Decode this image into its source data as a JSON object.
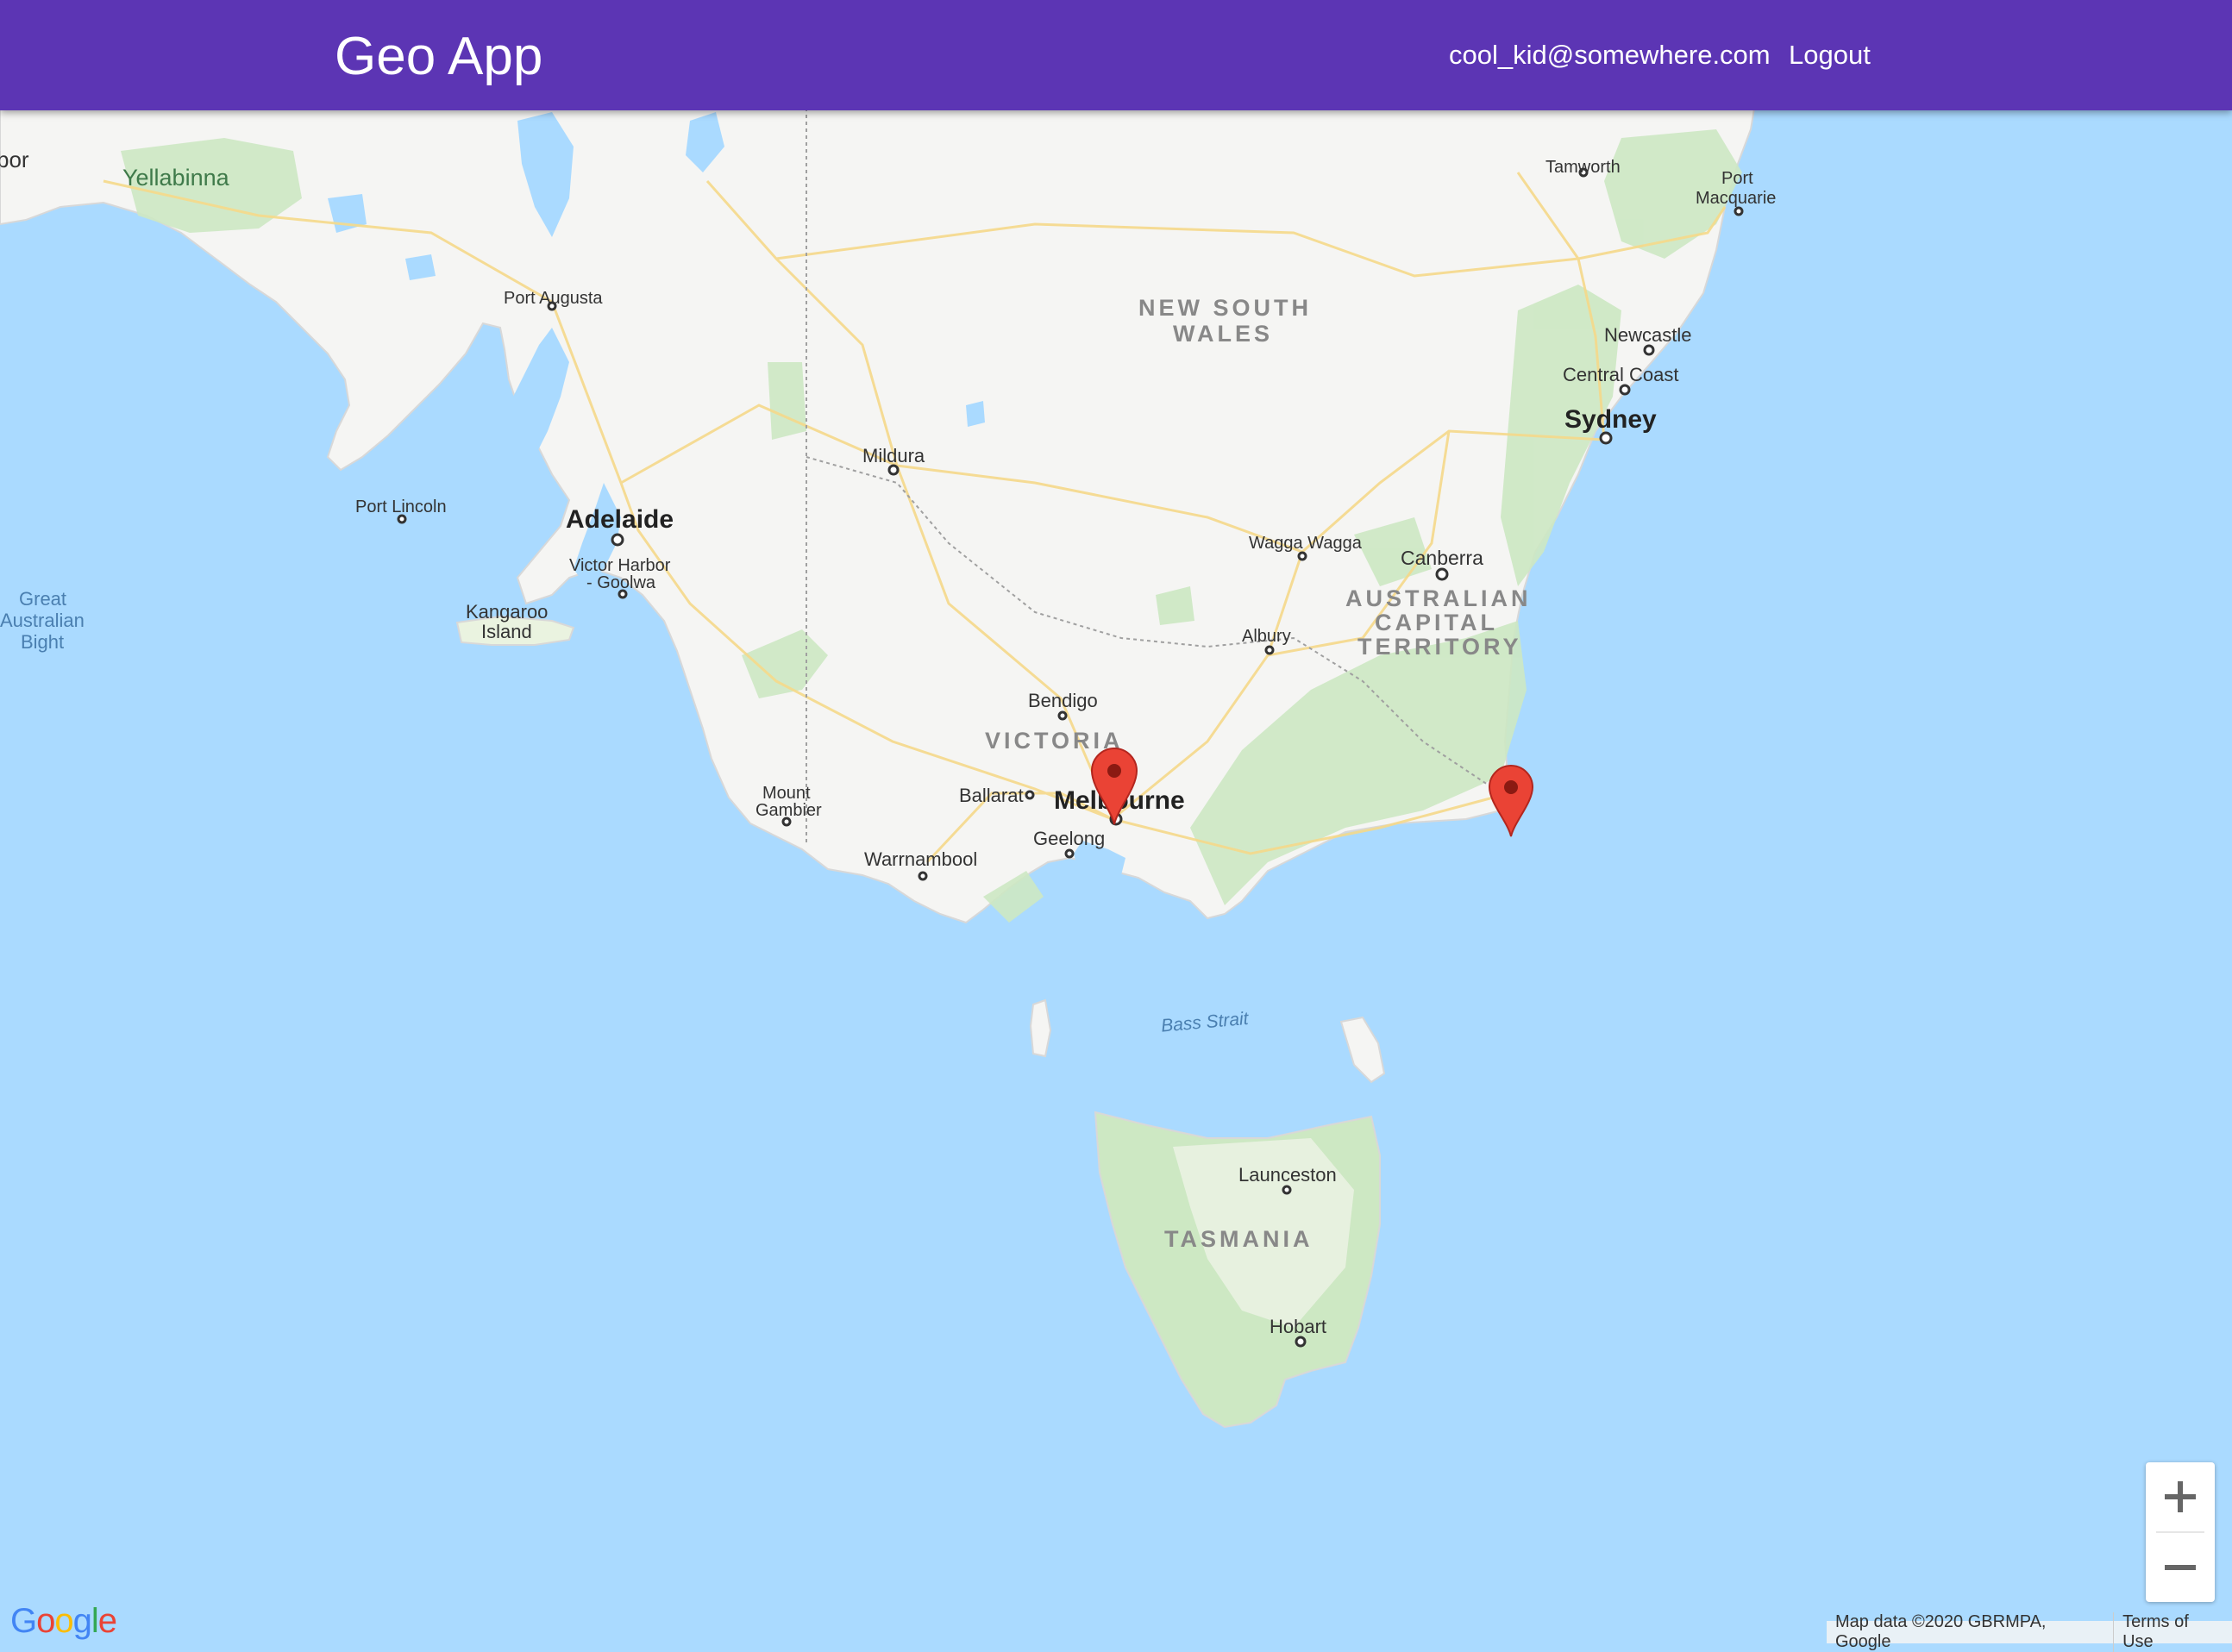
{
  "header": {
    "title": "Geo App",
    "user_email": "cool_kid@somewhere.com",
    "logout_label": "Logout"
  },
  "map": {
    "places": {
      "yellabinna": "Yellabinna",
      "bor": "bor",
      "port_augusta": "Port Augusta",
      "port_lincoln": "Port Lincoln",
      "adelaide": "Adelaide",
      "victor_harbor_1": "Victor Harbor",
      "victor_harbor_2": "- Goolwa",
      "kangaroo_1": "Kangaroo",
      "kangaroo_2": "Island",
      "mildura": "Mildura",
      "nsw_1": "NEW SOUTH",
      "nsw_2": "WALES",
      "tamworth": "Tamworth",
      "port_macquarie_1": "Port",
      "port_macquarie_2": "Macquarie",
      "newcastle": "Newcastle",
      "central_coast": "Central Coast",
      "sydney": "Sydney",
      "wagga": "Wagga Wagga",
      "canberra": "Canberra",
      "act_1": "AUSTRALIAN",
      "act_2": "CAPITAL",
      "act_3": "TERRITORY",
      "albury": "Albury",
      "bendigo": "Bendigo",
      "victoria": "VICTORIA",
      "ballarat": "Ballarat",
      "melbourne": "Melbourne",
      "geelong": "Geelong",
      "mount_gambier_1": "Mount",
      "mount_gambier_2": "Gambier",
      "warrnambool": "Warrnambool",
      "gab_1": "Great",
      "gab_2": "Australian",
      "gab_3": "Bight",
      "bass_strait": "Bass Strait",
      "launceston": "Launceston",
      "tasmania": "TASMANIA",
      "hobart": "Hobart"
    },
    "markers": [
      {
        "name": "Melbourne marker",
        "color": "#ea4335"
      },
      {
        "name": "East coast marker",
        "color": "#ea4335"
      }
    ],
    "zoom_in": "+",
    "zoom_out": "−",
    "google_logo": "Google",
    "attribution": "Map data ©2020 GBRMPA, Google",
    "terms": "Terms of Use"
  }
}
